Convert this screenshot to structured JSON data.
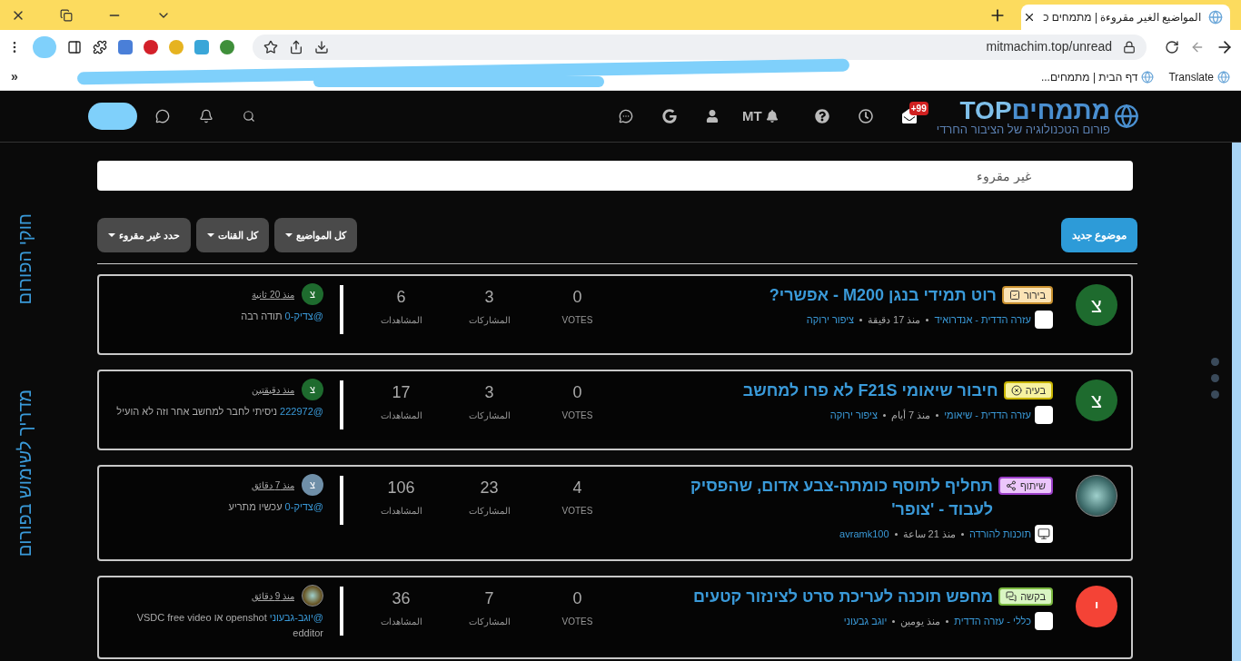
{
  "browser": {
    "tab_title": "المواضيع الغير مقروءة | מתמחים כ",
    "url": "mitmachim.top/unread",
    "bookmarks": [
      {
        "label": "Translate"
      },
      {
        "label": "דף הבית | מתמחים..."
      }
    ],
    "overflow": "»"
  },
  "header": {
    "logo_name": "מתמחים",
    "logo_suffix": "TOP",
    "tagline": "פורום הטכנולוגיה של הציבור החרדי",
    "user_initials": "MT",
    "notification_count": "+99"
  },
  "sidebar_links": [
    "חוקי הפורום",
    "מדריך לשימוש בפורום"
  ],
  "search": {
    "placeholder": "غير مقروء"
  },
  "toolbar": {
    "new_topic": "موضوع جديد",
    "filters": [
      "كل المواضيع",
      "كل القنات",
      "حدد غير مقروء"
    ]
  },
  "topics": [
    {
      "avatar": {
        "kind": "letter",
        "letter": "צ",
        "color": "#1e6b2e"
      },
      "badge": {
        "kind": "check",
        "label": "בירור",
        "color": "#c8902f"
      },
      "title": "רוט תמידי בנגן M200 - אפשרי?",
      "category": "עזרה הדדית - אנדרואיד",
      "time": "منذ 17 دقيقة",
      "author": "ציפור ירוקה",
      "stats": [
        {
          "value": "0",
          "label": "VOTES"
        },
        {
          "value": "3",
          "label": "المشاركات"
        },
        {
          "value": "6",
          "label": "المشاهدات"
        }
      ],
      "teaser": {
        "avatar": {
          "kind": "letter",
          "letter": "צ",
          "color": "#1e6b2e"
        },
        "time": "منذ 20 ثانية",
        "user": "@צדיק-0",
        "text": "תודה רבה"
      }
    },
    {
      "avatar": {
        "kind": "letter",
        "letter": "צ",
        "color": "#1e6b2e"
      },
      "badge": {
        "kind": "cross",
        "label": "בעיה",
        "color": "#c8b400"
      },
      "title": "חיבור שיאומי F21S לא פרו למחשב",
      "category": "עזרה הדדית - שיאומי",
      "time": "منذ 7 أيام",
      "author": "ציפור ירוקה",
      "stats": [
        {
          "value": "0",
          "label": "VOTES"
        },
        {
          "value": "3",
          "label": "المشاركات"
        },
        {
          "value": "17",
          "label": "المشاهدات"
        }
      ],
      "teaser": {
        "avatar": {
          "kind": "letter",
          "letter": "צ",
          "color": "#1e6b2e"
        },
        "time": "منذ دقيقتين",
        "user": "@222972",
        "text": "ניסיתי לחבר למחשב אחר וזה לא הועיל"
      }
    },
    {
      "avatar": {
        "kind": "photo",
        "color": "#3d6b6a"
      },
      "badge": {
        "kind": "share",
        "label": "שיתוף",
        "color": "#9b3fc8"
      },
      "title": "תחליף לתוסף כומתה-צבע אדום, שהפסיק לעבוד - 'צופר'",
      "category": "תוכנות להורדה",
      "time": "منذ 21 ساعة",
      "author": "avramk100",
      "stats": [
        {
          "value": "4",
          "label": "VOTES"
        },
        {
          "value": "23",
          "label": "المشاركات"
        },
        {
          "value": "106",
          "label": "المشاهدات"
        }
      ],
      "teaser": {
        "avatar": {
          "kind": "letter",
          "letter": "צ",
          "color": "#6f8fa8"
        },
        "time": "منذ 7 دقائق",
        "user": "@צדיק-0",
        "text": "עכשיו מתריע"
      }
    },
    {
      "avatar": {
        "kind": "letter",
        "letter": "י",
        "color": "#f44336"
      },
      "badge": {
        "kind": "chat",
        "label": "בקשה",
        "color": "#7ab840"
      },
      "title": "מחפש תוכנה לעריכת סרט לצינזור קטעים",
      "category": "כללי - עזרה הדדית",
      "time": "منذ يومين",
      "author": "יוגב גבעוני",
      "stats": [
        {
          "value": "0",
          "label": "VOTES"
        },
        {
          "value": "7",
          "label": "المشاركات"
        },
        {
          "value": "36",
          "label": "المشاهدات"
        }
      ],
      "teaser": {
        "avatar": {
          "kind": "photo",
          "color": "#6b5a2a"
        },
        "time": "منذ 9 دقائق",
        "user": "@יוגב-גבעוני",
        "text": "openshot או VSDC free video edditor"
      }
    }
  ]
}
